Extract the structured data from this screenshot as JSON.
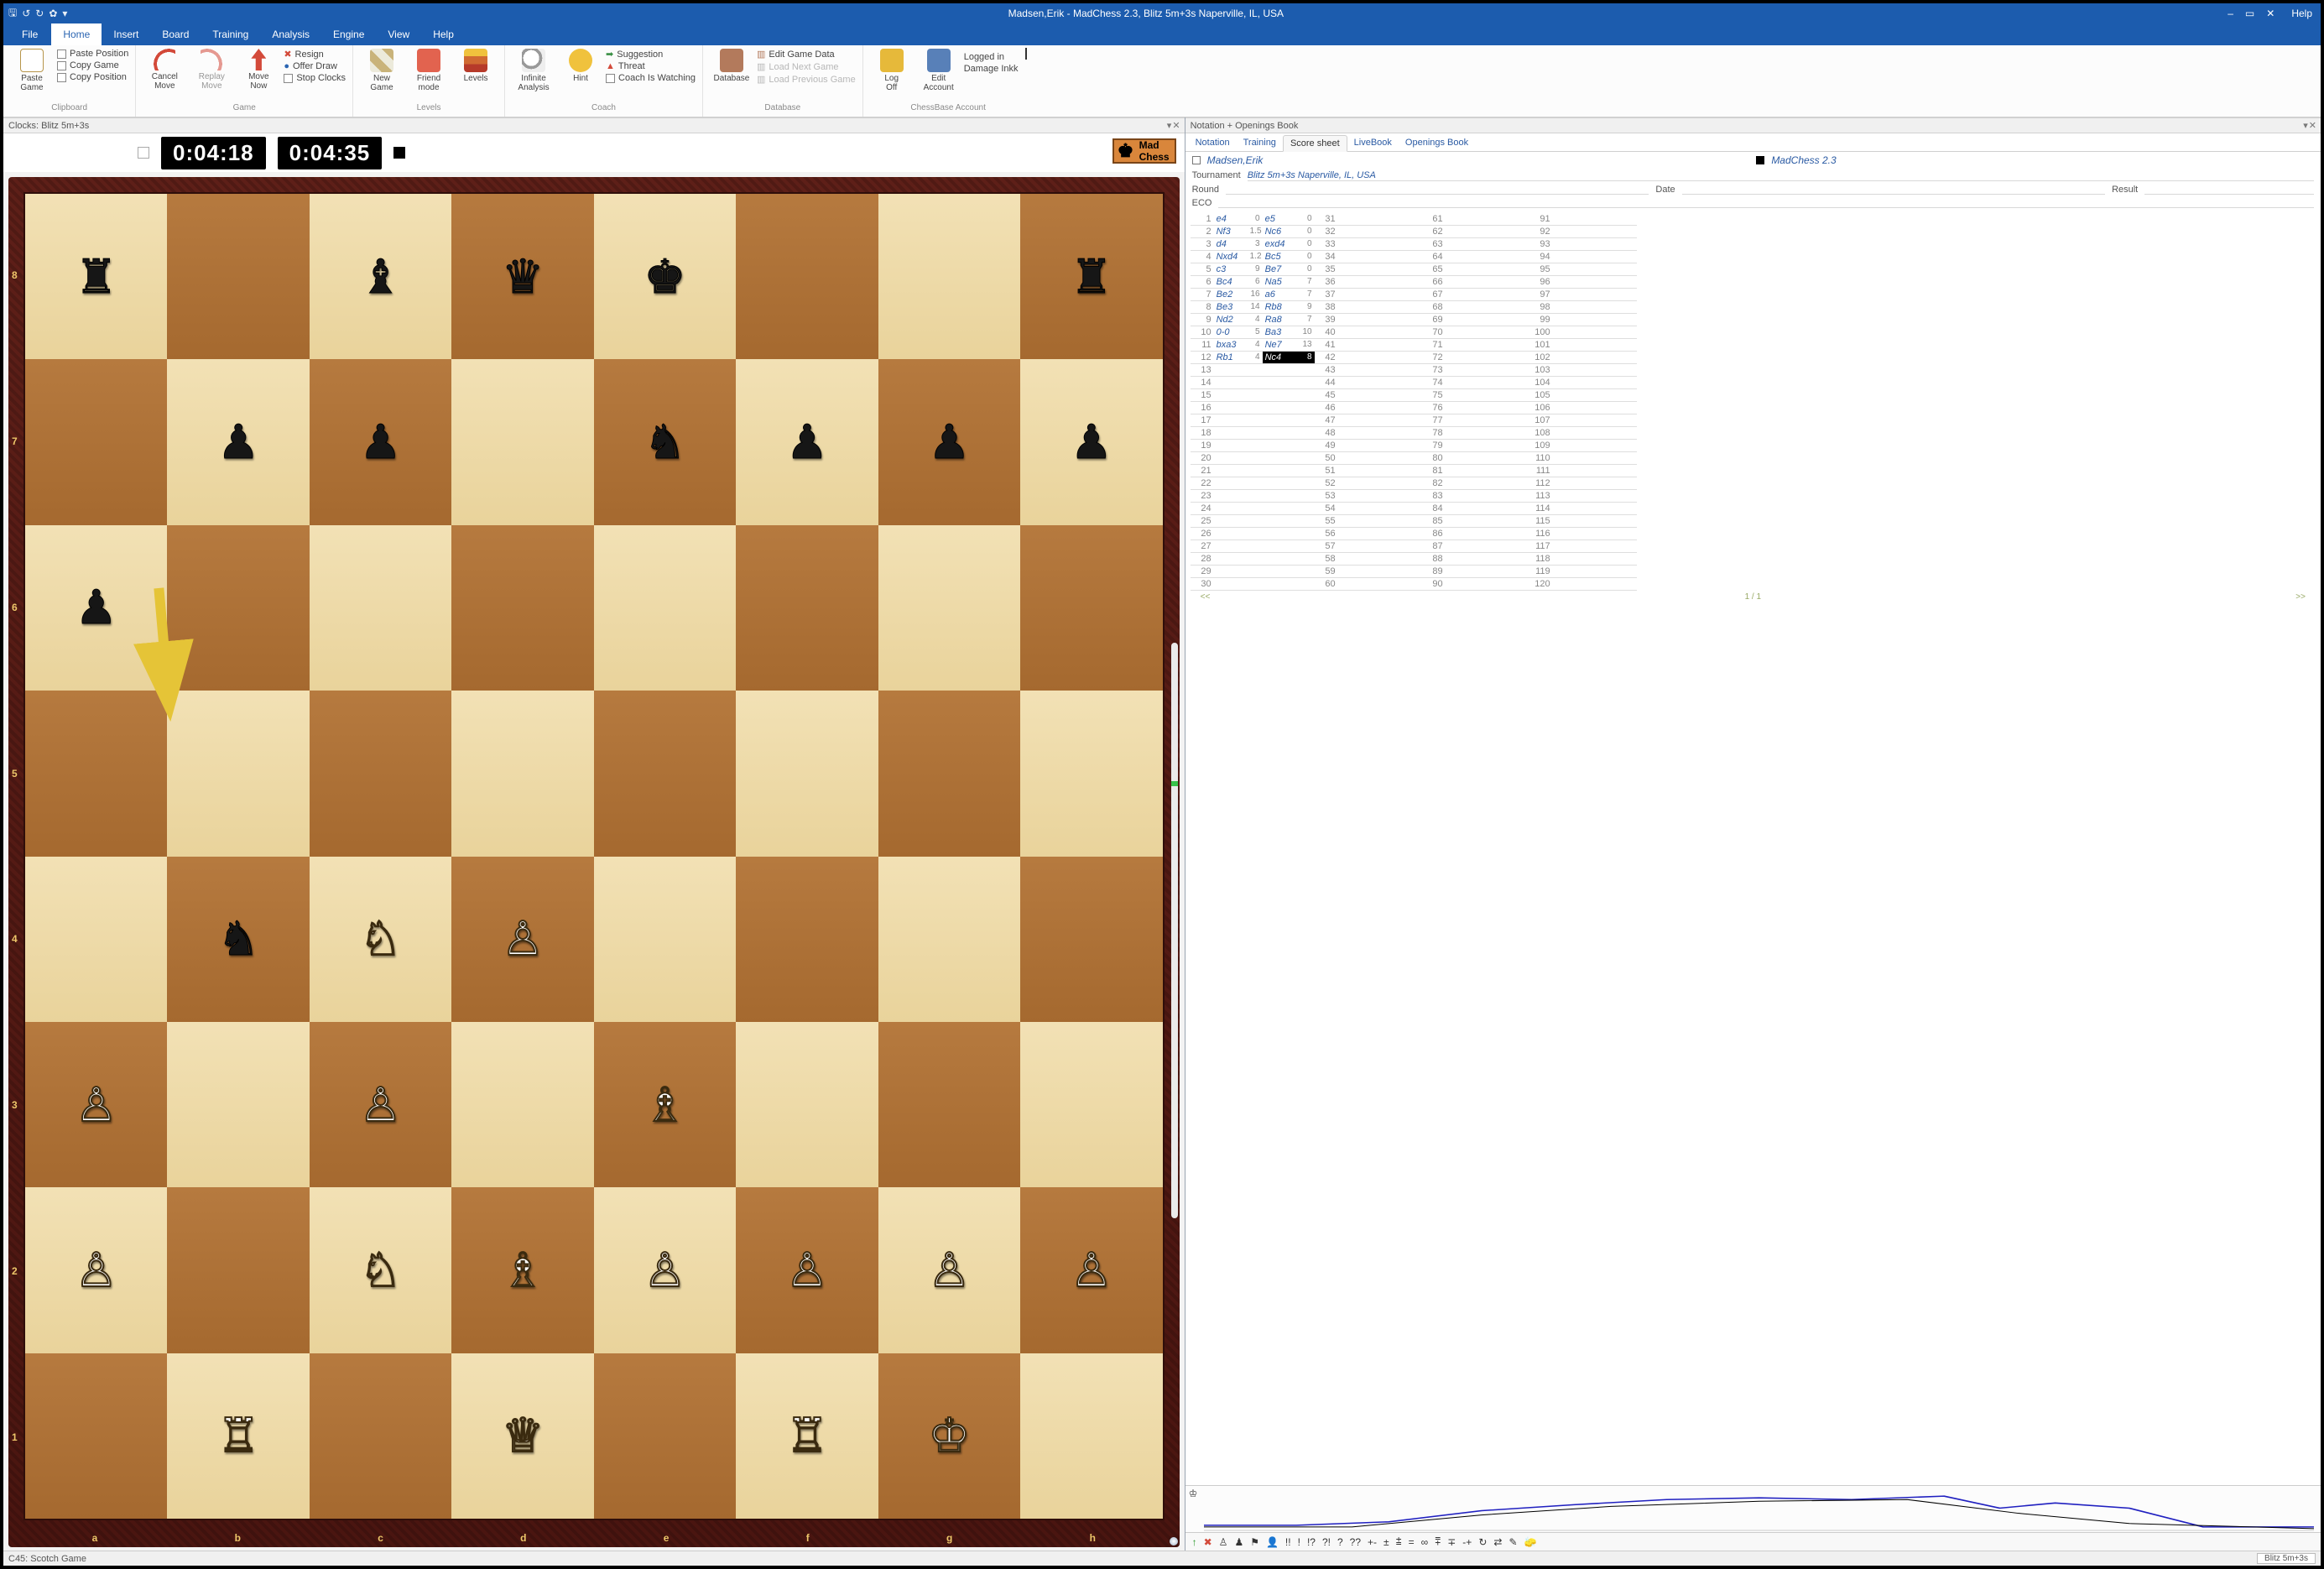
{
  "title_center": "Madsen,Erik - MadChess 2.3, Blitz 5m+3s Naperville, IL, USA",
  "title_help": "Help",
  "menu_tabs": {
    "file": "File",
    "home": "Home",
    "insert": "Insert",
    "board": "Board",
    "training": "Training",
    "analysis": "Analysis",
    "engine": "Engine",
    "view": "View",
    "help": "Help"
  },
  "ribbon": {
    "clipboard": {
      "label": "Clipboard",
      "paste": "Paste\nGame",
      "paste_pos": "Paste Position",
      "copy_game": "Copy Game",
      "copy_pos": "Copy Position"
    },
    "game": {
      "label": "Game",
      "cancel": "Cancel\nMove",
      "replay": "Replay\nMove",
      "movenow": "Move\nNow",
      "resign": "Resign",
      "offerdraw": "Offer Draw",
      "stopclocks": "Stop Clocks"
    },
    "levels": {
      "label": "Levels",
      "newgame": "New\nGame",
      "friendmode": "Friend\nmode",
      "levels": "Levels"
    },
    "coach": {
      "label": "Coach",
      "infinite": "Infinite\nAnalysis",
      "hint": "Hint",
      "suggestion": "Suggestion",
      "threat": "Threat",
      "watching": "Coach Is Watching"
    },
    "database": {
      "label": "Database",
      "database": "Database",
      "edit": "Edit Game Data",
      "loadnext": "Load Next Game",
      "loadprev": "Load Previous Game"
    },
    "account": {
      "label": "ChessBase Account",
      "logoff": "Log\nOff",
      "editacct": "Edit\nAccount",
      "loggedin": "Logged in",
      "username": "Damage Inkk"
    }
  },
  "clocks": {
    "title": "Clocks: Blitz 5m+3s",
    "white": "0:04:18",
    "black": "0:04:35",
    "engine_name": "Mad\nChess"
  },
  "coords": {
    "ranks": [
      "8",
      "7",
      "6",
      "5",
      "4",
      "3",
      "2",
      "1"
    ],
    "files": [
      "a",
      "b",
      "c",
      "d",
      "e",
      "f",
      "g",
      "h"
    ]
  },
  "board": {
    "rows": [
      [
        "r",
        "",
        "b",
        "q",
        "k",
        "",
        "",
        "r"
      ],
      [
        "",
        "p",
        "p",
        "",
        "n",
        "p",
        "p",
        "p"
      ],
      [
        "p",
        "",
        "",
        "",
        "",
        "",
        "",
        ""
      ],
      [
        "",
        "",
        "",
        "",
        "",
        "",
        "",
        ""
      ],
      [
        "",
        "n",
        "N",
        "P",
        "",
        "",
        "",
        ""
      ],
      [
        "P",
        "",
        "P",
        "",
        "B",
        "",
        "",
        ""
      ],
      [
        "P",
        "",
        "N",
        "B",
        "P",
        "P",
        "P",
        "P"
      ],
      [
        "",
        "R",
        "",
        "Q",
        "",
        "R",
        "K",
        ""
      ]
    ]
  },
  "notation_panel_title": "Notation + Openings Book",
  "notation_tabs": [
    "Notation",
    "Training",
    "Score sheet",
    "LiveBook",
    "Openings Book"
  ],
  "notation_active_tab": "Score sheet",
  "players": {
    "white": "Madsen,Erik",
    "black": "MadChess 2.3"
  },
  "tournament_label": "Tournament",
  "tournament": "Blitz 5m+3s Naperville, IL, USA",
  "meta": {
    "round": "Round",
    "date": "Date",
    "result": "Result",
    "eco": "ECO"
  },
  "moves": [
    {
      "n": 1,
      "w": "e4",
      "wt": "0",
      "b": "e5",
      "bt": "0"
    },
    {
      "n": 2,
      "w": "Nf3",
      "wt": "1.5",
      "b": "Nc6",
      "bt": "0"
    },
    {
      "n": 3,
      "w": "d4",
      "wt": "3",
      "b": "exd4",
      "bt": "0"
    },
    {
      "n": 4,
      "w": "Nxd4",
      "wt": "1.2",
      "b": "Bc5",
      "bt": "0"
    },
    {
      "n": 5,
      "w": "c3",
      "wt": "9",
      "b": "Be7",
      "bt": "0"
    },
    {
      "n": 6,
      "w": "Bc4",
      "wt": "6",
      "b": "Na5",
      "bt": "7"
    },
    {
      "n": 7,
      "w": "Be2",
      "wt": "16",
      "b": "a6",
      "bt": "7"
    },
    {
      "n": 8,
      "w": "Be3",
      "wt": "14",
      "b": "Rb8",
      "bt": "9"
    },
    {
      "n": 9,
      "w": "Nd2",
      "wt": "4",
      "b": "Ra8",
      "bt": "7"
    },
    {
      "n": 10,
      "w": "0-0",
      "wt": "5",
      "b": "Ba3",
      "bt": "10"
    },
    {
      "n": 11,
      "w": "bxa3",
      "wt": "4",
      "b": "Ne7",
      "bt": "13"
    },
    {
      "n": 12,
      "w": "Rb1",
      "wt": "4",
      "b": "Nc4",
      "bt": "8",
      "current": true
    }
  ],
  "extra_cols": {
    "col2_start": 31,
    "col3_start": 61,
    "col4_start": 91,
    "col2_first": "31",
    "col3_first": "40"
  },
  "pager": {
    "prev": "<<",
    "page": "1 / 1",
    "next": ">>"
  },
  "annot": [
    "↑",
    "✖",
    "♙",
    "♟",
    "⚑",
    "👤",
    "!!",
    "!",
    "!?",
    "?!",
    "?",
    "??",
    "+-",
    "±",
    "⩲",
    "=",
    "∞",
    "⩱",
    "∓",
    "-+",
    "↻",
    "⇄",
    "✎",
    "🧽"
  ],
  "status_left": "C45: Scotch Game",
  "status_right": "Blitz 5m+3s"
}
